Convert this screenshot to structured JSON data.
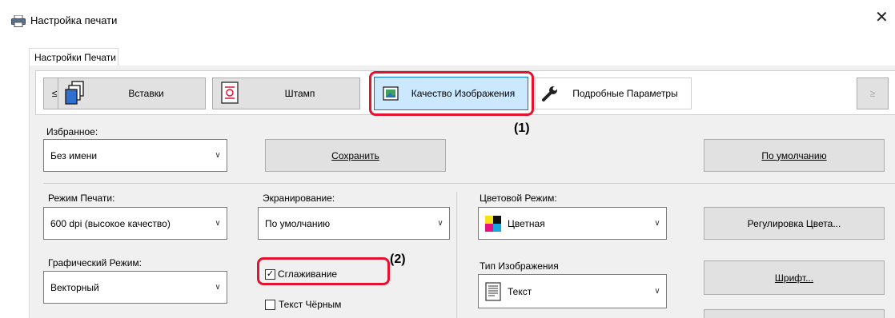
{
  "window": {
    "title": "Настройка печати",
    "close_glyph": "✕"
  },
  "tabs": [
    {
      "label": "Настройки Печати"
    }
  ],
  "toolbar": {
    "prev": "≤",
    "next": "≥",
    "items": [
      {
        "label": "Вставки",
        "icon": "inserts-icon"
      },
      {
        "label": "Штамп",
        "icon": "stamp-icon"
      },
      {
        "label": "Качество Изображения",
        "icon": "image-quality-icon"
      },
      {
        "label": "Подробные Параметры",
        "icon": "wrench-icon"
      }
    ]
  },
  "favorites": {
    "label": "Избранное:",
    "value": "Без имени",
    "save_label": "Сохранить",
    "default_label": "По умолчанию"
  },
  "print_mode": {
    "label": "Режим Печати:",
    "value": "600 dpi (высокое качество)"
  },
  "screening": {
    "label": "Экранирование:",
    "value": "По умолчанию"
  },
  "color_mode": {
    "label": "Цветовой Режим:",
    "value": "Цветная",
    "adjust_label": "Регулировка Цвета..."
  },
  "graphics_mode": {
    "label": "Графический Режим:",
    "value": "Векторный"
  },
  "smoothing": {
    "label": "Сглаживание",
    "checked": true
  },
  "text_black": {
    "label": "Текст Чёрным",
    "checked": false
  },
  "image_type": {
    "label": "Тип Изображения",
    "value": "Текст"
  },
  "font_button": "Шрифт...",
  "callouts": {
    "one": "(1)",
    "two": "(2)"
  },
  "colors": {
    "highlight": "#e5122f",
    "selected_tab_bg": "#cce8ff",
    "selected_tab_border": "#0078d7"
  }
}
